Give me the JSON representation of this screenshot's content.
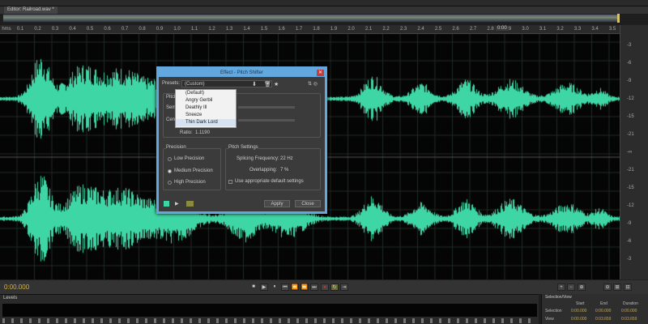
{
  "editor": {
    "tab": "Editor: Railroad.wav *"
  },
  "ruler": {
    "unit": "hms",
    "ticks": [
      "0.1",
      "0.2",
      "0.3",
      "0.4",
      "0.5",
      "0.6",
      "0.7",
      "0.8",
      "0.9",
      "1.0",
      "1.1",
      "1.2",
      "1.3",
      "1.4",
      "1.5",
      "1.6",
      "1.7",
      "1.8",
      "1.9",
      "2.0",
      "2.1",
      "2.2",
      "2.3",
      "2.4",
      "2.5",
      "2.6",
      "2.7",
      "2.8",
      "2.9",
      "3.0",
      "3.1",
      "3.2",
      "3.3",
      "3.4",
      "3.5"
    ],
    "zoom_readout": "0:00"
  },
  "db_scale": {
    "unit": "dB",
    "labels": [
      "-3",
      "-6",
      "-9",
      "-12",
      "-15",
      "-21",
      "-∞",
      "-21",
      "-15",
      "-12",
      "-9",
      "-6",
      "-3"
    ]
  },
  "dialog": {
    "title": "Effect - Pitch Shifter",
    "presets_label": "Presets:",
    "preset_value": "(Custom)",
    "preset_menu": [
      "(Default)",
      "Angry Gerbil",
      "Deathly Ill",
      "Sneeze",
      "Thin Dark Lord"
    ],
    "selected_preset": "Thin Dark Lord",
    "pitch_transpose": "Pitch Transpose",
    "semitones_label": "Semi-tones:",
    "cents_label": "Cents:",
    "ratio_label": "Ratio:",
    "ratio_value": "1.1190",
    "precision": {
      "title": "Precision",
      "options": [
        "Low Precision",
        "Medium Precision",
        "High Precision"
      ],
      "selected": "Medium Precision"
    },
    "pitch_settings": {
      "title": "Pitch Settings",
      "splicing_label": "Splicing Frequency:",
      "splicing_value": "22 Hz",
      "overlapping_label": "Overlapping:",
      "overlapping_value": "7 %",
      "default_label": "Use appropriate default settings"
    },
    "apply": "Apply",
    "close": "Close"
  },
  "transport": {
    "time": "0:00.000"
  },
  "levels": {
    "title": "Levels"
  },
  "selection": {
    "title": "Selection/View",
    "cols": [
      "Start",
      "End",
      "Duration"
    ],
    "rows": [
      {
        "label": "Selection",
        "values": [
          "0:00.000",
          "0:00.000",
          "0:00.000"
        ]
      },
      {
        "label": "View",
        "values": [
          "0:00.000",
          "0:03.659",
          "0:03.659"
        ]
      }
    ]
  },
  "colors": {
    "waveform": "#3fd6a5",
    "dialog_border": "#62a8df",
    "time": "#d2b24c"
  }
}
